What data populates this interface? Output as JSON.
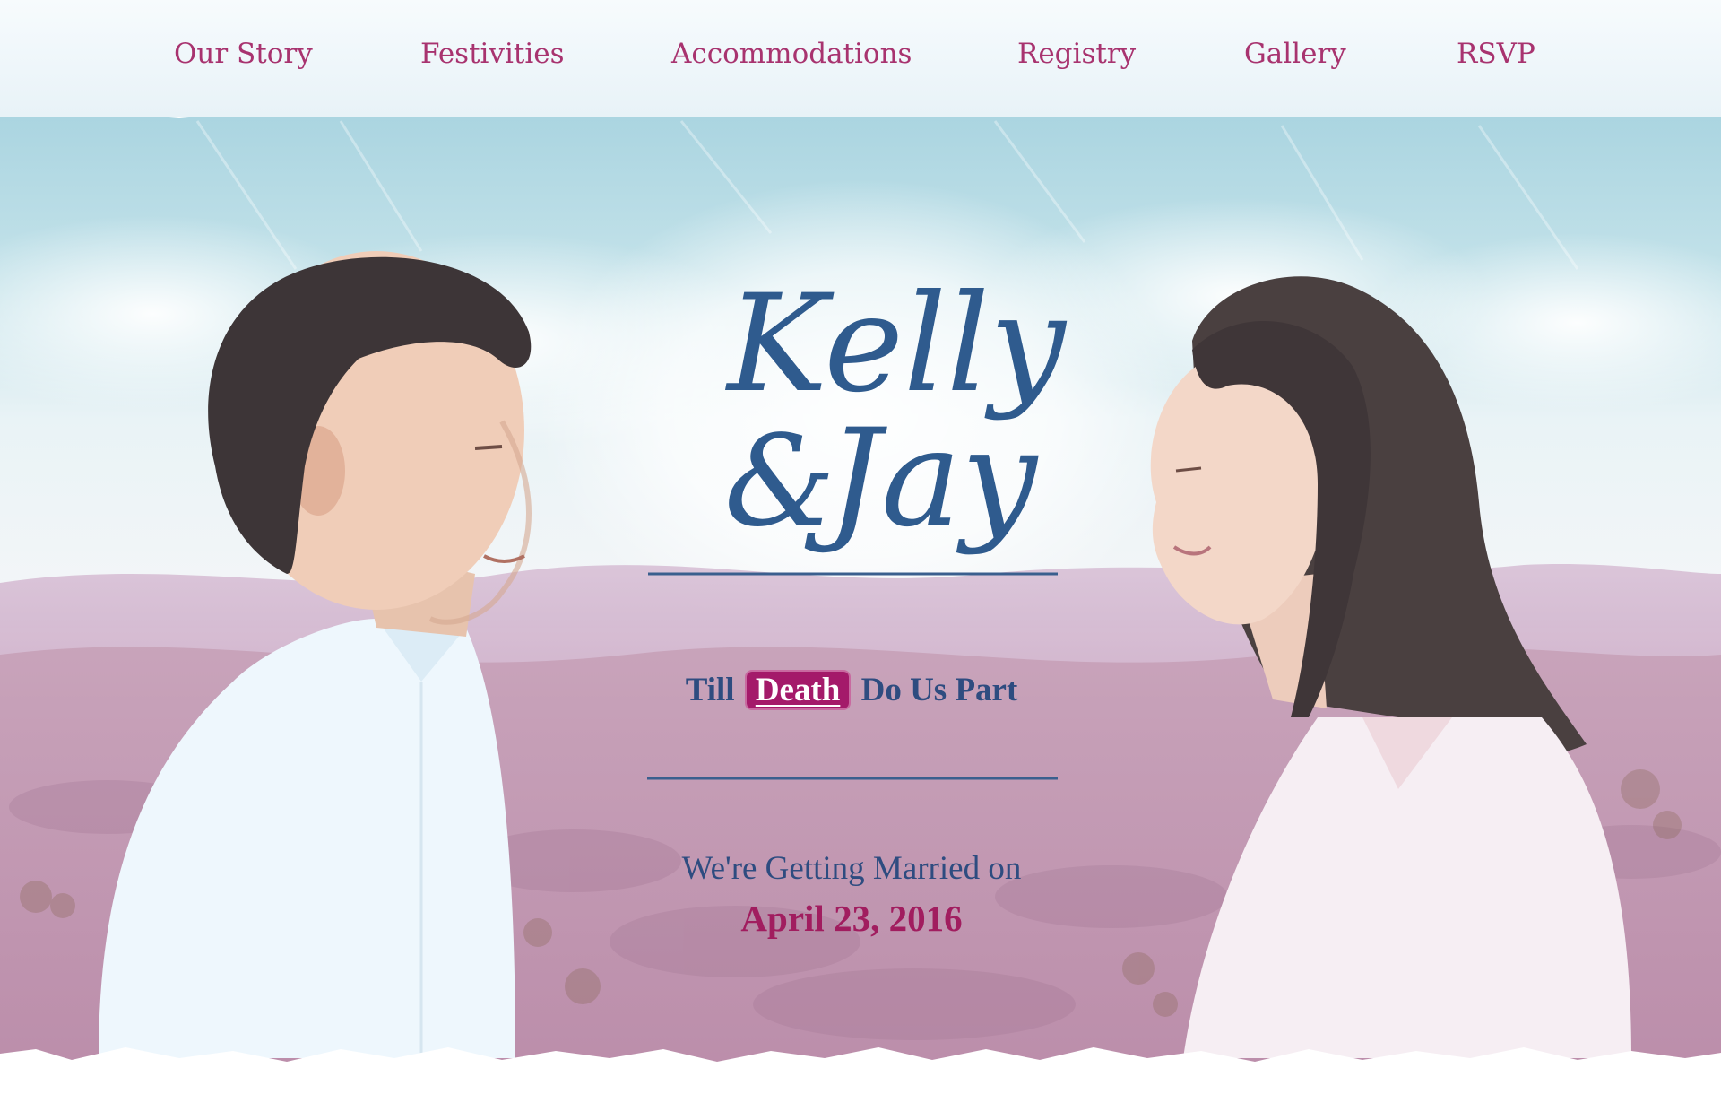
{
  "nav": {
    "items": [
      {
        "label": "Our Story"
      },
      {
        "label": "Festivities"
      },
      {
        "label": "Accommodations"
      },
      {
        "label": "Registry"
      },
      {
        "label": "Gallery"
      },
      {
        "label": "RSVP"
      }
    ]
  },
  "hero": {
    "name_first": "Kelly",
    "ampersand": "&",
    "name_second": "Jay",
    "tagline_before": "Till",
    "tagline_highlight": "Death",
    "tagline_after": "Do Us Part",
    "married_text": "We're Getting Married on",
    "date": "April 23, 2016"
  },
  "colors": {
    "accent": "#a8336f",
    "title_blue": "#2f5b8e",
    "highlight_bg": "#a41a6a"
  }
}
